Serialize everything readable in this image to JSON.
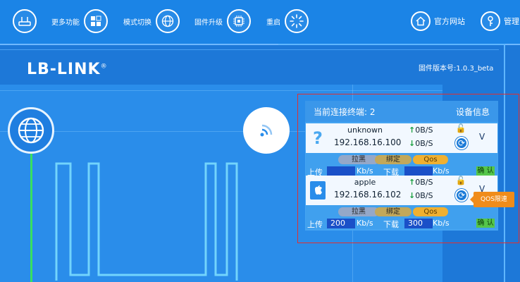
{
  "topnav": {
    "router_icon": "router-icon",
    "more_label": "更多功能",
    "mode_label": "模式切换",
    "firmware_label": "固件升级",
    "reboot_label": "重启",
    "website_label": "官方网站",
    "manage_label": "管理"
  },
  "brand": {
    "logo": "LB-LINK",
    "reg": "®"
  },
  "version": "固件版本号:1.0.3_beta",
  "devices_panel": {
    "title": "当前连接终端: 2",
    "info_label": "设备信息",
    "devices": [
      {
        "icon": "?",
        "name": "unknown",
        "ip": "192.168.16.100",
        "up": "0B/S",
        "down": "0B/S",
        "lock": "🔓",
        "v": "V",
        "blacklist": "拉黑",
        "bind": "绑定",
        "qos": "Qos",
        "upload_label": "上传",
        "upload_value": "",
        "unit1": "Kb/s",
        "download_label": "下载",
        "download_value": "",
        "unit2": "Kb/s",
        "confirm": "确 认"
      },
      {
        "icon": "",
        "name": "apple",
        "ip": "192.168.16.102",
        "up": "0B/S",
        "down": "0B/S",
        "lock": "🔓",
        "v": "V",
        "blacklist": "拉黑",
        "bind": "绑定",
        "qos": "Qos",
        "upload_label": "上传",
        "upload_value": "200",
        "unit1": "Kb/s",
        "download_label": "下载",
        "download_value": "300",
        "unit2": "Kb/s",
        "confirm": "确 认"
      }
    ]
  },
  "tooltip": "QOS限速",
  "colors": {
    "accent": "#1b84e6",
    "highlight": "#e03030",
    "qos": "#f0b030"
  }
}
